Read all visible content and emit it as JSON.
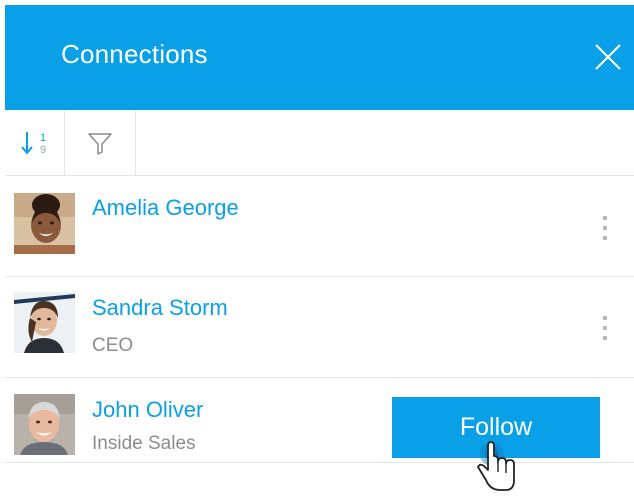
{
  "header": {
    "title": "Connections",
    "close_icon": "close-icon",
    "background": "#0aa0e8"
  },
  "toolbar": {
    "sort_icon": "sort-numeric-icon",
    "sort_top_digit": "1",
    "sort_bottom_digit": "9",
    "filter_icon": "filter-icon"
  },
  "connections": [
    {
      "name": "Amelia George",
      "role": "",
      "action": "menu"
    },
    {
      "name": "Sandra Storm",
      "role": "CEO",
      "action": "menu"
    },
    {
      "name": "John Oliver",
      "role": "Inside Sales",
      "action": "follow"
    }
  ],
  "follow_label": "Follow",
  "colors": {
    "accent": "#0aa0e8",
    "muted_text": "#8c8c8c",
    "divider": "#e3e6e8"
  }
}
